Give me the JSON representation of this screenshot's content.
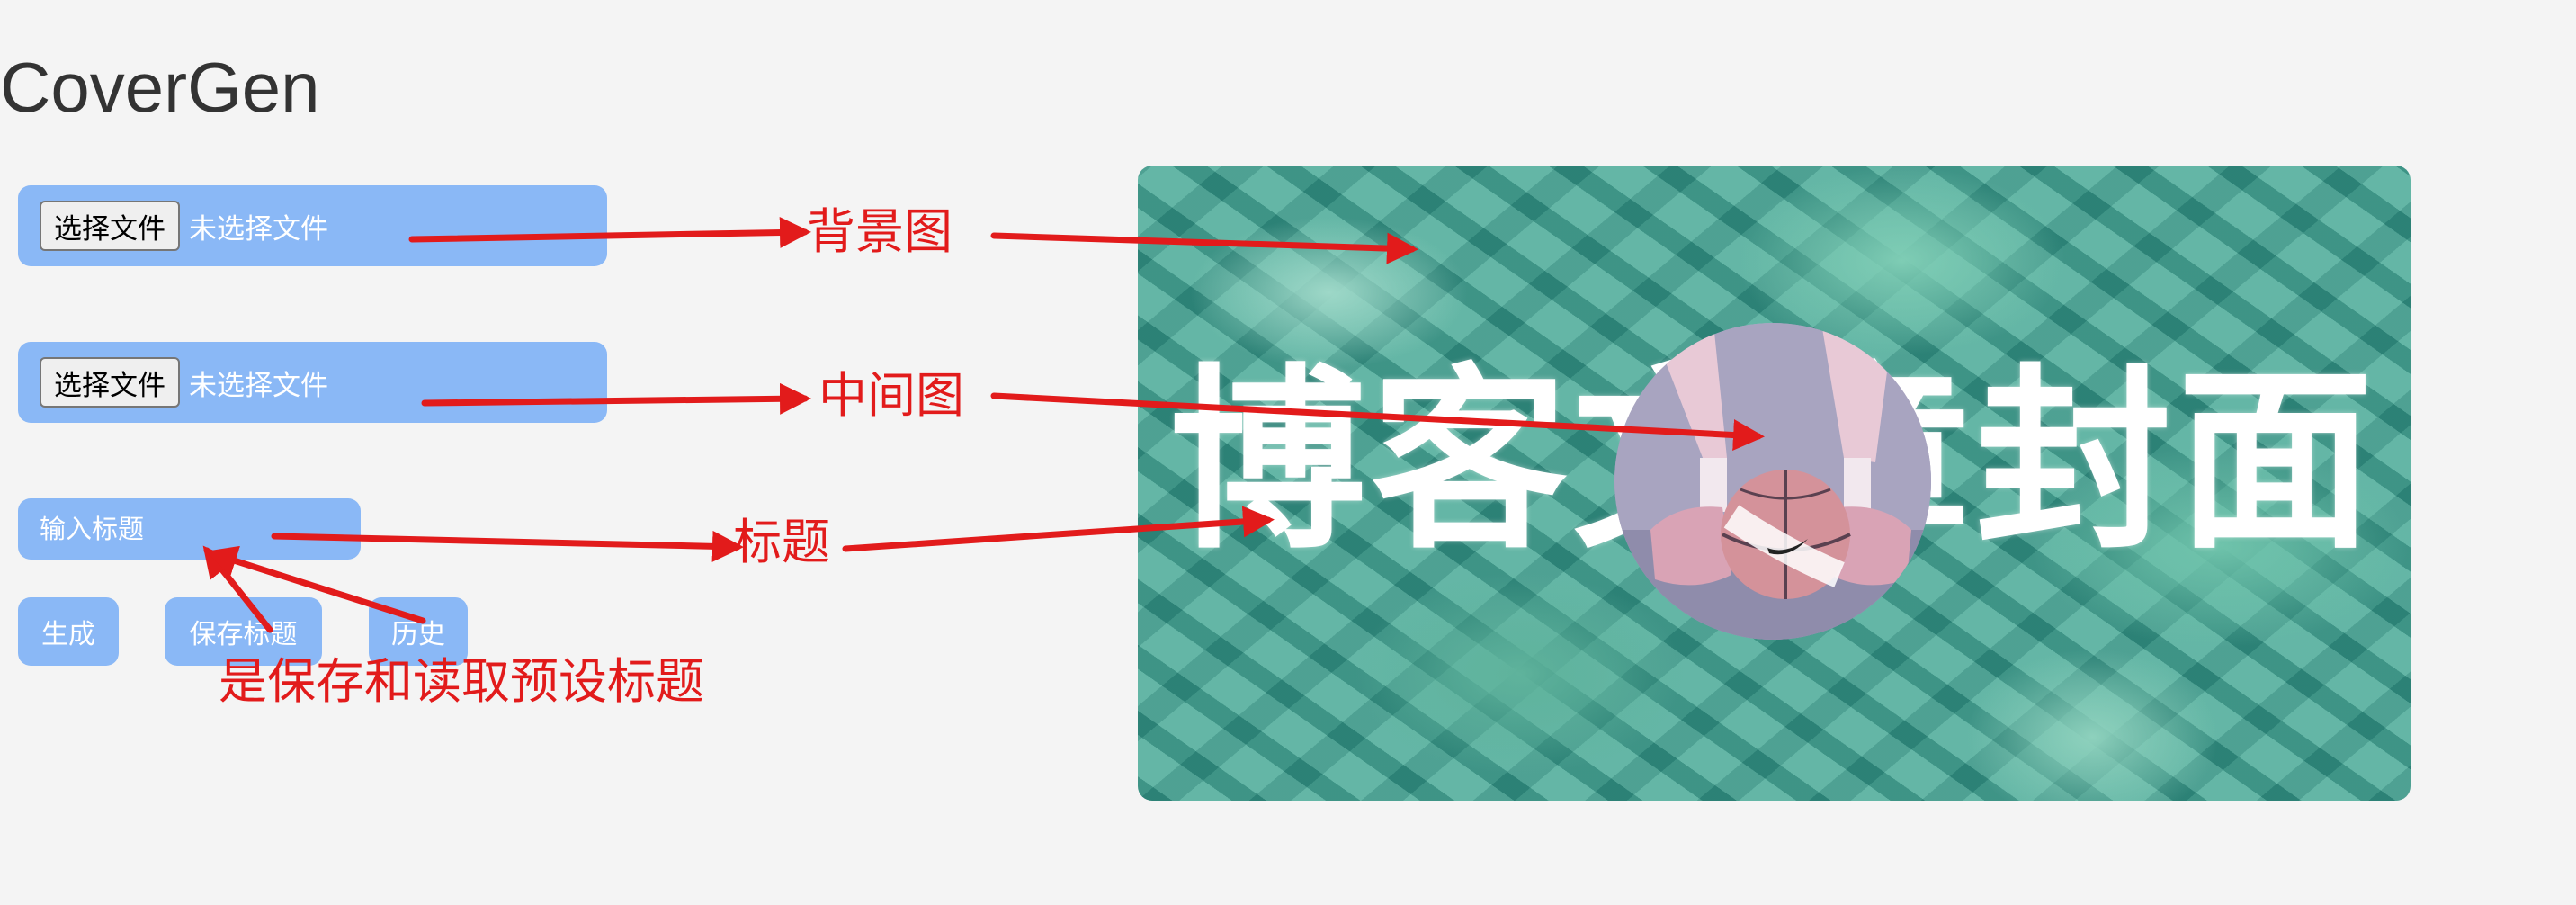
{
  "app": {
    "title": "CoverGen"
  },
  "background_upload": {
    "button_label": "选择文件",
    "status": "未选择文件"
  },
  "middle_upload": {
    "button_label": "选择文件",
    "status": "未选择文件"
  },
  "title_input": {
    "placeholder": "输入标题",
    "value": ""
  },
  "actions": {
    "generate": "生成",
    "save_title": "保存标题",
    "history": "历史"
  },
  "preview": {
    "title_text": "博客文章封面"
  },
  "annotations": {
    "background": "背景图",
    "middle": "中间图",
    "title": "标题",
    "save_history_note": "是保存和读取预设标题"
  },
  "colors": {
    "panel": "#8ab8f6",
    "annotation_red": "#e21b1b",
    "page_bg": "#f4f4f4",
    "preview_teal": "#3e9c8e"
  },
  "icons": {
    "ball": "basketball-icon",
    "brand": "swoosh-icon"
  }
}
